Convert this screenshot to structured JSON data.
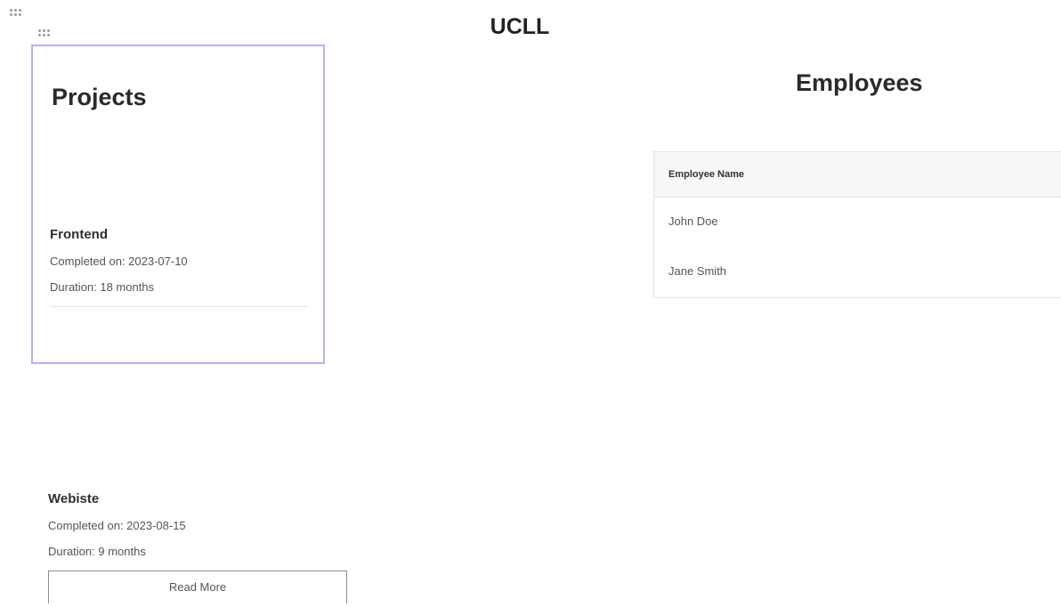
{
  "page": {
    "title": "UCLL"
  },
  "projects": {
    "heading": "Projects",
    "items": [
      {
        "name": "Frontend",
        "completed": "Completed on: 2023-07-10",
        "duration": "Duration: 18 months"
      },
      {
        "name": "Webiste",
        "completed": "Completed on: 2023-08-15",
        "duration": "Duration: 9 months",
        "button_label": "Read More"
      }
    ]
  },
  "employees": {
    "heading": "Employees",
    "columns": [
      "Employee Name"
    ],
    "rows": [
      [
        "John Doe"
      ],
      [
        "Jane Smith"
      ]
    ]
  },
  "colors": {
    "selection_border": "#b9b1ee",
    "drag_handle": "#9a9ab0"
  }
}
